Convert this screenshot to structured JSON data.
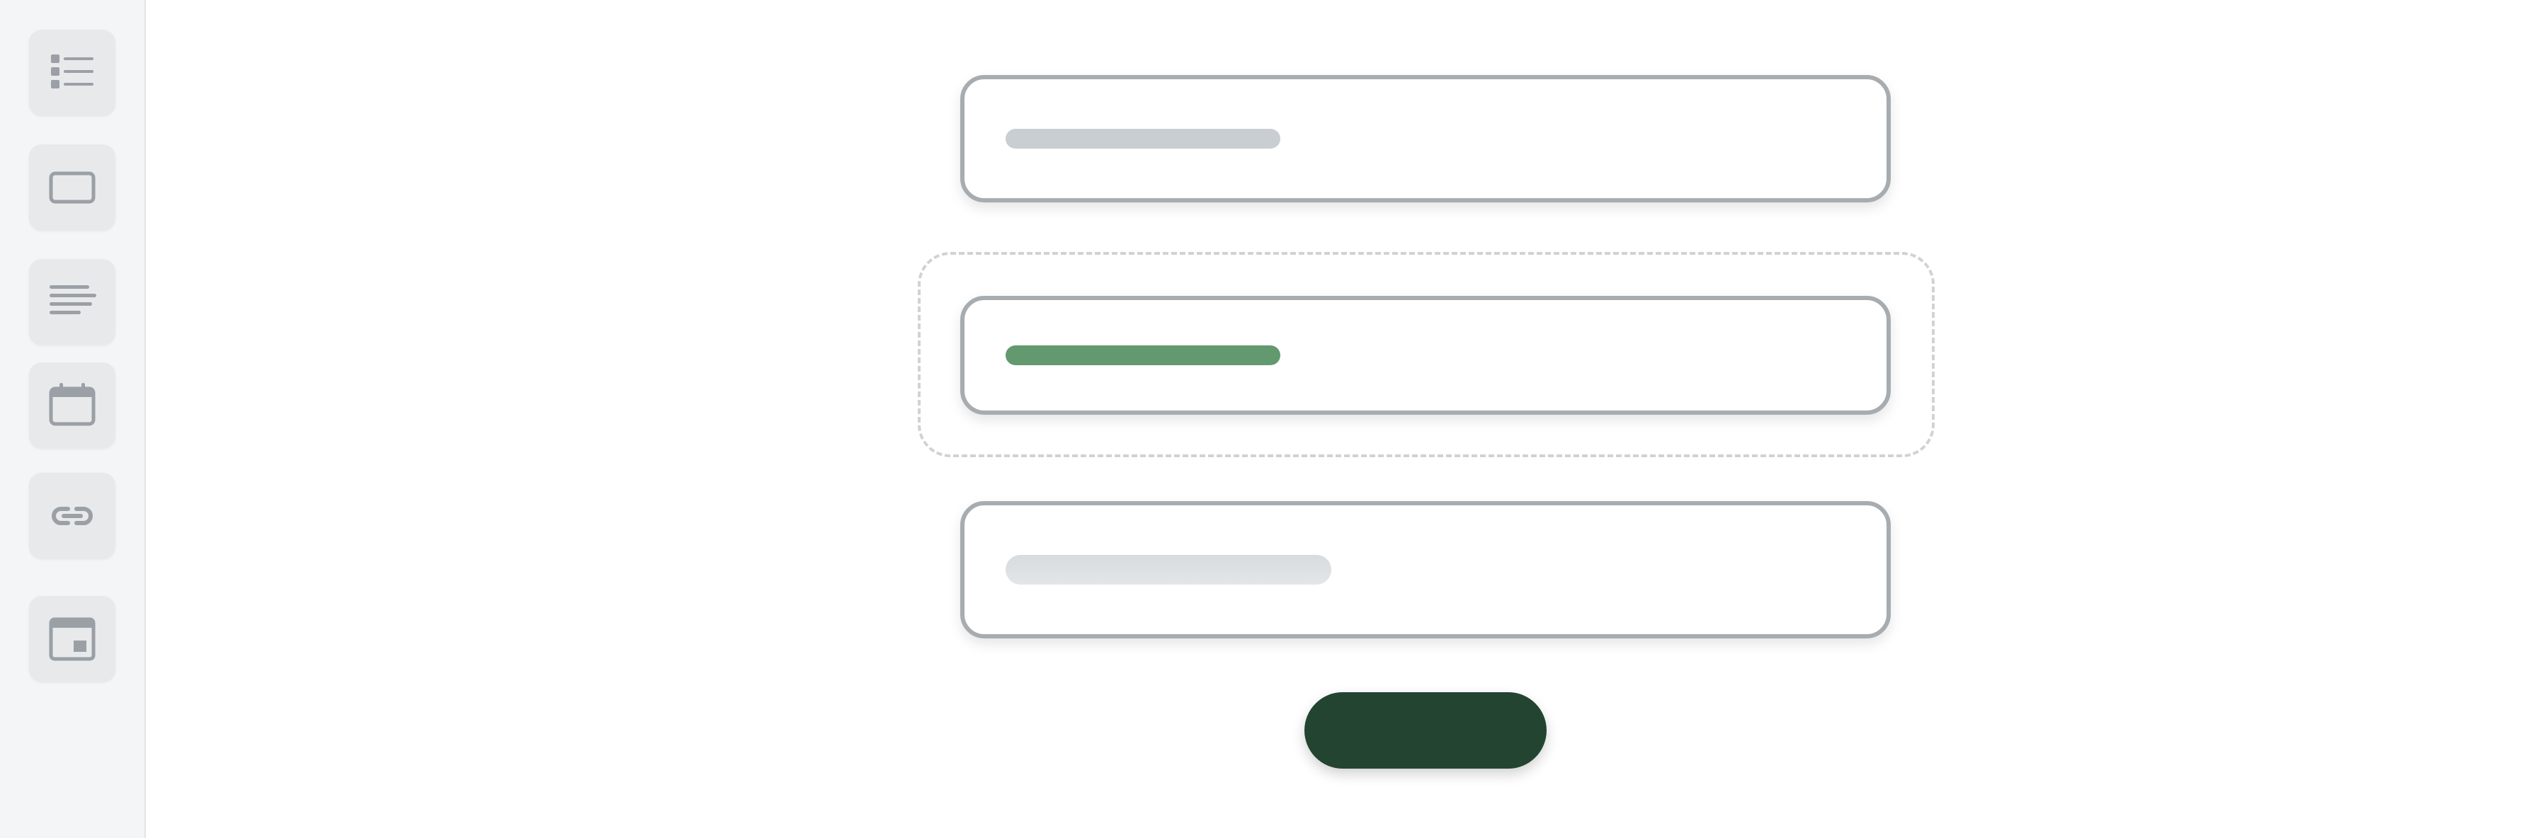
{
  "toolbar": {
    "items": [
      {
        "icon": "list-icon"
      },
      {
        "icon": "rectangle-icon"
      },
      {
        "icon": "text-lines-icon"
      },
      {
        "icon": "calendar-icon"
      },
      {
        "icon": "link-icon"
      },
      {
        "icon": "layout-icon"
      }
    ]
  },
  "form": {
    "fields": [
      {
        "state": "default"
      },
      {
        "state": "selected"
      },
      {
        "state": "placeholder"
      }
    ],
    "submit_label": ""
  },
  "colors": {
    "accent_green": "#63996f",
    "button_dark_green": "#234431",
    "field_border": "#a6acb0",
    "icon_gray": "#9aa0a5",
    "sidebar_bg": "#f3f5f6"
  }
}
